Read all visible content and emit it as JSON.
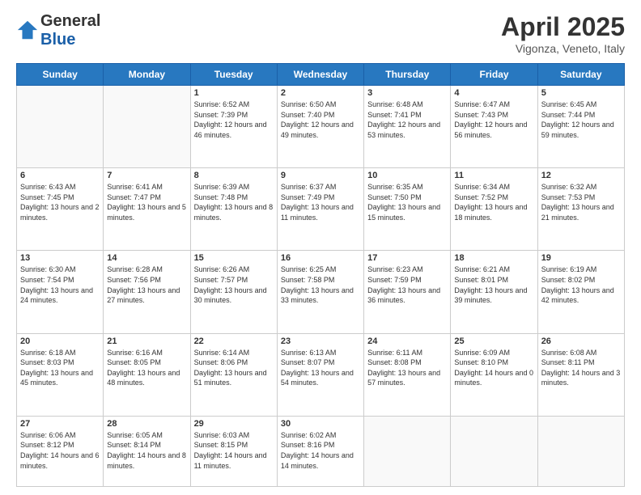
{
  "logo": {
    "general": "General",
    "blue": "Blue"
  },
  "title": "April 2025",
  "subtitle": "Vigonza, Veneto, Italy",
  "days_of_week": [
    "Sunday",
    "Monday",
    "Tuesday",
    "Wednesday",
    "Thursday",
    "Friday",
    "Saturday"
  ],
  "weeks": [
    [
      {
        "day": "",
        "info": ""
      },
      {
        "day": "",
        "info": ""
      },
      {
        "day": "1",
        "info": "Sunrise: 6:52 AM\nSunset: 7:39 PM\nDaylight: 12 hours and 46 minutes."
      },
      {
        "day": "2",
        "info": "Sunrise: 6:50 AM\nSunset: 7:40 PM\nDaylight: 12 hours and 49 minutes."
      },
      {
        "day": "3",
        "info": "Sunrise: 6:48 AM\nSunset: 7:41 PM\nDaylight: 12 hours and 53 minutes."
      },
      {
        "day": "4",
        "info": "Sunrise: 6:47 AM\nSunset: 7:43 PM\nDaylight: 12 hours and 56 minutes."
      },
      {
        "day": "5",
        "info": "Sunrise: 6:45 AM\nSunset: 7:44 PM\nDaylight: 12 hours and 59 minutes."
      }
    ],
    [
      {
        "day": "6",
        "info": "Sunrise: 6:43 AM\nSunset: 7:45 PM\nDaylight: 13 hours and 2 minutes."
      },
      {
        "day": "7",
        "info": "Sunrise: 6:41 AM\nSunset: 7:47 PM\nDaylight: 13 hours and 5 minutes."
      },
      {
        "day": "8",
        "info": "Sunrise: 6:39 AM\nSunset: 7:48 PM\nDaylight: 13 hours and 8 minutes."
      },
      {
        "day": "9",
        "info": "Sunrise: 6:37 AM\nSunset: 7:49 PM\nDaylight: 13 hours and 11 minutes."
      },
      {
        "day": "10",
        "info": "Sunrise: 6:35 AM\nSunset: 7:50 PM\nDaylight: 13 hours and 15 minutes."
      },
      {
        "day": "11",
        "info": "Sunrise: 6:34 AM\nSunset: 7:52 PM\nDaylight: 13 hours and 18 minutes."
      },
      {
        "day": "12",
        "info": "Sunrise: 6:32 AM\nSunset: 7:53 PM\nDaylight: 13 hours and 21 minutes."
      }
    ],
    [
      {
        "day": "13",
        "info": "Sunrise: 6:30 AM\nSunset: 7:54 PM\nDaylight: 13 hours and 24 minutes."
      },
      {
        "day": "14",
        "info": "Sunrise: 6:28 AM\nSunset: 7:56 PM\nDaylight: 13 hours and 27 minutes."
      },
      {
        "day": "15",
        "info": "Sunrise: 6:26 AM\nSunset: 7:57 PM\nDaylight: 13 hours and 30 minutes."
      },
      {
        "day": "16",
        "info": "Sunrise: 6:25 AM\nSunset: 7:58 PM\nDaylight: 13 hours and 33 minutes."
      },
      {
        "day": "17",
        "info": "Sunrise: 6:23 AM\nSunset: 7:59 PM\nDaylight: 13 hours and 36 minutes."
      },
      {
        "day": "18",
        "info": "Sunrise: 6:21 AM\nSunset: 8:01 PM\nDaylight: 13 hours and 39 minutes."
      },
      {
        "day": "19",
        "info": "Sunrise: 6:19 AM\nSunset: 8:02 PM\nDaylight: 13 hours and 42 minutes."
      }
    ],
    [
      {
        "day": "20",
        "info": "Sunrise: 6:18 AM\nSunset: 8:03 PM\nDaylight: 13 hours and 45 minutes."
      },
      {
        "day": "21",
        "info": "Sunrise: 6:16 AM\nSunset: 8:05 PM\nDaylight: 13 hours and 48 minutes."
      },
      {
        "day": "22",
        "info": "Sunrise: 6:14 AM\nSunset: 8:06 PM\nDaylight: 13 hours and 51 minutes."
      },
      {
        "day": "23",
        "info": "Sunrise: 6:13 AM\nSunset: 8:07 PM\nDaylight: 13 hours and 54 minutes."
      },
      {
        "day": "24",
        "info": "Sunrise: 6:11 AM\nSunset: 8:08 PM\nDaylight: 13 hours and 57 minutes."
      },
      {
        "day": "25",
        "info": "Sunrise: 6:09 AM\nSunset: 8:10 PM\nDaylight: 14 hours and 0 minutes."
      },
      {
        "day": "26",
        "info": "Sunrise: 6:08 AM\nSunset: 8:11 PM\nDaylight: 14 hours and 3 minutes."
      }
    ],
    [
      {
        "day": "27",
        "info": "Sunrise: 6:06 AM\nSunset: 8:12 PM\nDaylight: 14 hours and 6 minutes."
      },
      {
        "day": "28",
        "info": "Sunrise: 6:05 AM\nSunset: 8:14 PM\nDaylight: 14 hours and 8 minutes."
      },
      {
        "day": "29",
        "info": "Sunrise: 6:03 AM\nSunset: 8:15 PM\nDaylight: 14 hours and 11 minutes."
      },
      {
        "day": "30",
        "info": "Sunrise: 6:02 AM\nSunset: 8:16 PM\nDaylight: 14 hours and 14 minutes."
      },
      {
        "day": "",
        "info": ""
      },
      {
        "day": "",
        "info": ""
      },
      {
        "day": "",
        "info": ""
      }
    ]
  ]
}
